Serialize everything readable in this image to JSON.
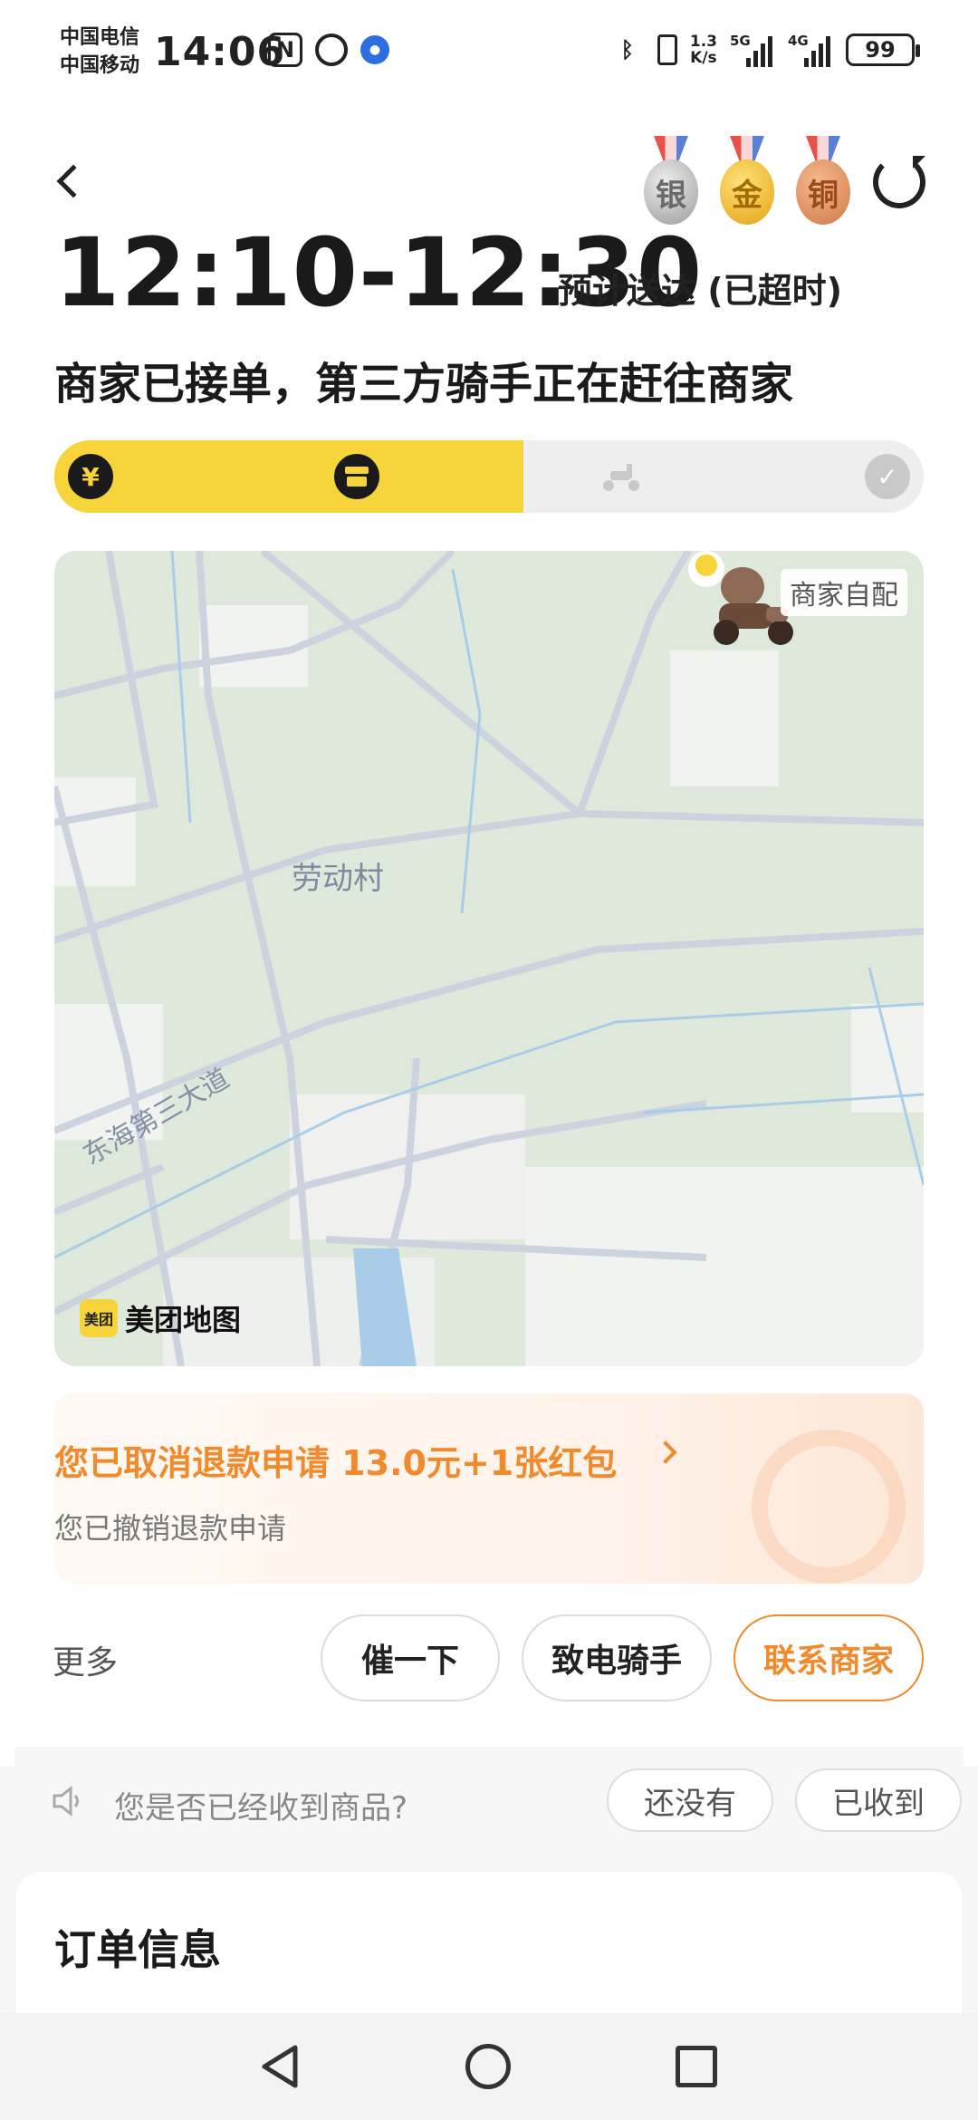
{
  "status_bar": {
    "carrier_1": "中国电信",
    "carrier_2": "中国移动",
    "time": "14:06",
    "net_speed_value": "1.3",
    "net_speed_unit": "K/s",
    "signal_1_label": "5G",
    "signal_2_label": "4G",
    "battery": "99"
  },
  "header": {
    "medals": [
      "银",
      "金",
      "铜"
    ],
    "eta_time": "12:10-12:30",
    "eta_label": "预计送达 (已超时)",
    "status_text": "商家已接单，第三方骑手正在赶往商家"
  },
  "progress": {
    "fraction": 0.54,
    "steps": [
      {
        "icon": "yuan-icon",
        "glyph": "¥",
        "state": "done"
      },
      {
        "icon": "store-icon",
        "glyph": "▀",
        "state": "done"
      },
      {
        "icon": "scooter-icon",
        "glyph": "",
        "state": "todo"
      },
      {
        "icon": "check-icon",
        "glyph": "✓",
        "state": "todo"
      }
    ]
  },
  "map": {
    "village_label": "劳动村",
    "road_label": "东海第三大道",
    "delivery_tag": "商家自配",
    "logo_badge": "美团",
    "logo_text": "美团地图"
  },
  "refund": {
    "title": "您已取消退款申请 13.0元+1张红包",
    "subtitle": "您已撤销退款申请",
    "accent_color": "#f08a2c"
  },
  "actions": {
    "more_label": "更多",
    "urge": "催一下",
    "call_rider": "致电骑手",
    "contact_merchant": "联系商家"
  },
  "receipt": {
    "question": "您是否已经收到商品?",
    "not_yet": "还没有",
    "received": "已收到"
  },
  "order_info": {
    "title": "订单信息"
  },
  "colors": {
    "brand_yellow": "#f8d43b",
    "accent_orange": "#f08a2c"
  }
}
